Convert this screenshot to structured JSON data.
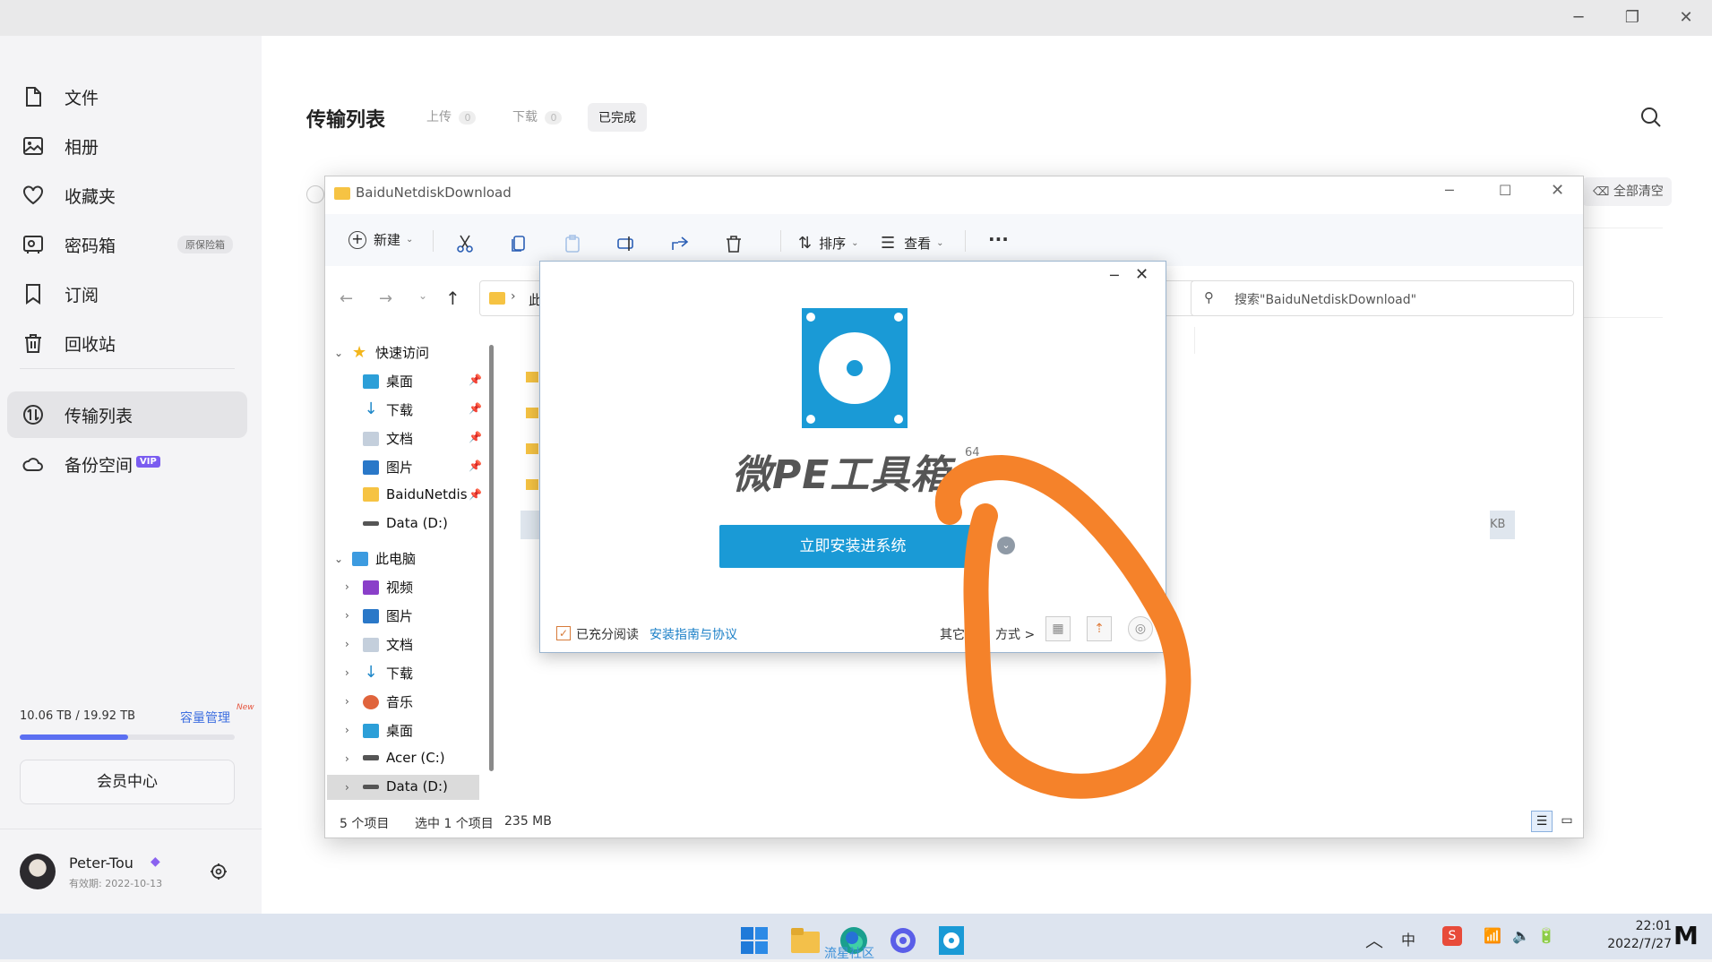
{
  "window_controls": {
    "minimize": "─",
    "restore": "❐",
    "close": "✕"
  },
  "sidebar": {
    "items": [
      {
        "label": "文件",
        "icon": "file-icon"
      },
      {
        "label": "相册",
        "icon": "photo-icon"
      },
      {
        "label": "收藏夹",
        "icon": "heart-icon"
      },
      {
        "label": "密码箱",
        "icon": "safe-icon",
        "badge": "原保险箱"
      },
      {
        "label": "订阅",
        "icon": "bookmark-icon"
      },
      {
        "label": "回收站",
        "icon": "trash-icon"
      },
      {
        "label": "传输列表",
        "icon": "transfer-icon",
        "active": true
      },
      {
        "label": "备份空间",
        "icon": "cloud-icon",
        "badge": "VIP"
      }
    ],
    "storage": {
      "text": "10.06 TB / 19.92 TB",
      "manage": "容量管理",
      "new_tag": "New",
      "used_fraction": 0.505
    },
    "member_center": "会员中心",
    "user": {
      "name": "Peter-Tou",
      "expiry": "有效期: 2022-10-13"
    }
  },
  "main": {
    "title": "传输列表",
    "tabs": [
      {
        "label": "上传",
        "count": "0"
      },
      {
        "label": "下载",
        "count": "0"
      },
      {
        "label": "已完成"
      }
    ],
    "clear_all": "全部清空"
  },
  "explorer": {
    "title": "BaiduNetdiskDownload",
    "toolbar": {
      "new": "新建",
      "sort": "排序",
      "view": "查看",
      "more": "···"
    },
    "address_partial": "此",
    "search_placeholder": "搜索\"BaiduNetdiskDownload\"",
    "size_partial": "KB",
    "tree": {
      "quick_access": "快速访问",
      "quick_items": [
        "桌面",
        "下载",
        "文档",
        "图片",
        "BaiduNetdis",
        "Data (D:)"
      ],
      "this_pc": "此电脑",
      "pc_items": [
        "视频",
        "图片",
        "文档",
        "下载",
        "音乐",
        "桌面",
        "Acer (C:)",
        "Data (D:)"
      ]
    },
    "status": {
      "count": "5 个项目",
      "selected": "选中 1 个项目",
      "size": "235 MB"
    }
  },
  "pe_dialog": {
    "app_name": "微PE工具箱",
    "version_sup": "64",
    "install_button": "立即安装进系统",
    "agree_prefix": "已充分阅读",
    "agree_link": "安装指南与协议",
    "other_methods_a": "其它",
    "other_methods_b": "方式 >",
    "accent": "#1a9ad6"
  },
  "taskbar": {
    "time": "22:01",
    "date": "2022/7/27",
    "ime": "中",
    "watermark": "流星社区",
    "logo": "M"
  },
  "annotation": {
    "color": "#f5822a"
  }
}
